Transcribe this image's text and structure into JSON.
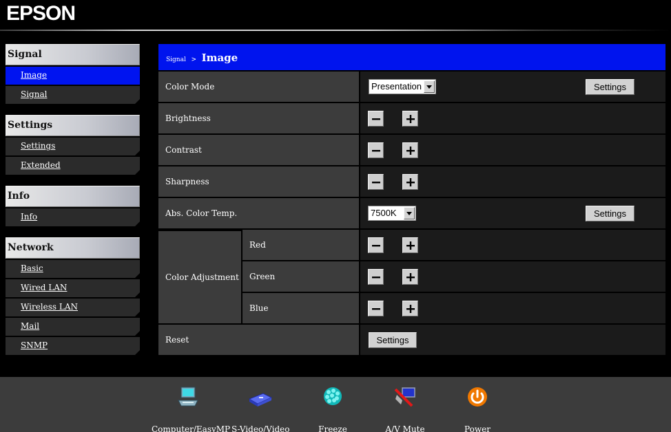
{
  "brand": {
    "logo": "EPSON"
  },
  "sidebar": {
    "sections": [
      {
        "title": "Signal",
        "items": [
          "Image",
          "Signal"
        ]
      },
      {
        "title": "Settings",
        "items": [
          "Settings",
          "Extended"
        ]
      },
      {
        "title": "Info",
        "items": [
          "Info"
        ]
      },
      {
        "title": "Network",
        "items": [
          "Basic",
          "Wired LAN",
          "Wireless LAN",
          "Mail",
          "SNMP"
        ]
      }
    ],
    "active_item": "Image"
  },
  "main": {
    "breadcrumb": "Signal",
    "separator": ">",
    "title": "Image",
    "rows": {
      "color_mode": {
        "label": "Color Mode",
        "value": "Presentation",
        "button": "Settings"
      },
      "brightness": {
        "label": "Brightness"
      },
      "contrast": {
        "label": "Contrast"
      },
      "sharpness": {
        "label": "Sharpness"
      },
      "abs_color_temp": {
        "label": "Abs. Color Temp.",
        "value": "7500K",
        "button": "Settings"
      },
      "color_adjustment": {
        "label": "Color Adjustment",
        "red": "Red",
        "green": "Green",
        "blue": "Blue"
      },
      "reset": {
        "label": "Reset",
        "button": "Settings"
      }
    }
  },
  "footer": {
    "buttons": [
      {
        "label": "Computer/EasyMP",
        "icon": "computer-icon"
      },
      {
        "label": "S-Video/Video",
        "icon": "video-device-icon"
      },
      {
        "label": "Freeze",
        "icon": "freeze-icon"
      },
      {
        "label": "A/V Mute",
        "icon": "av-mute-icon"
      },
      {
        "label": "Power",
        "icon": "power-icon"
      }
    ]
  },
  "colors": {
    "accent_blue": "#0014ee",
    "row_label_bg": "#3c3c3c",
    "row_control_bg": "#1b1b1b",
    "power_orange": "#f07800"
  }
}
